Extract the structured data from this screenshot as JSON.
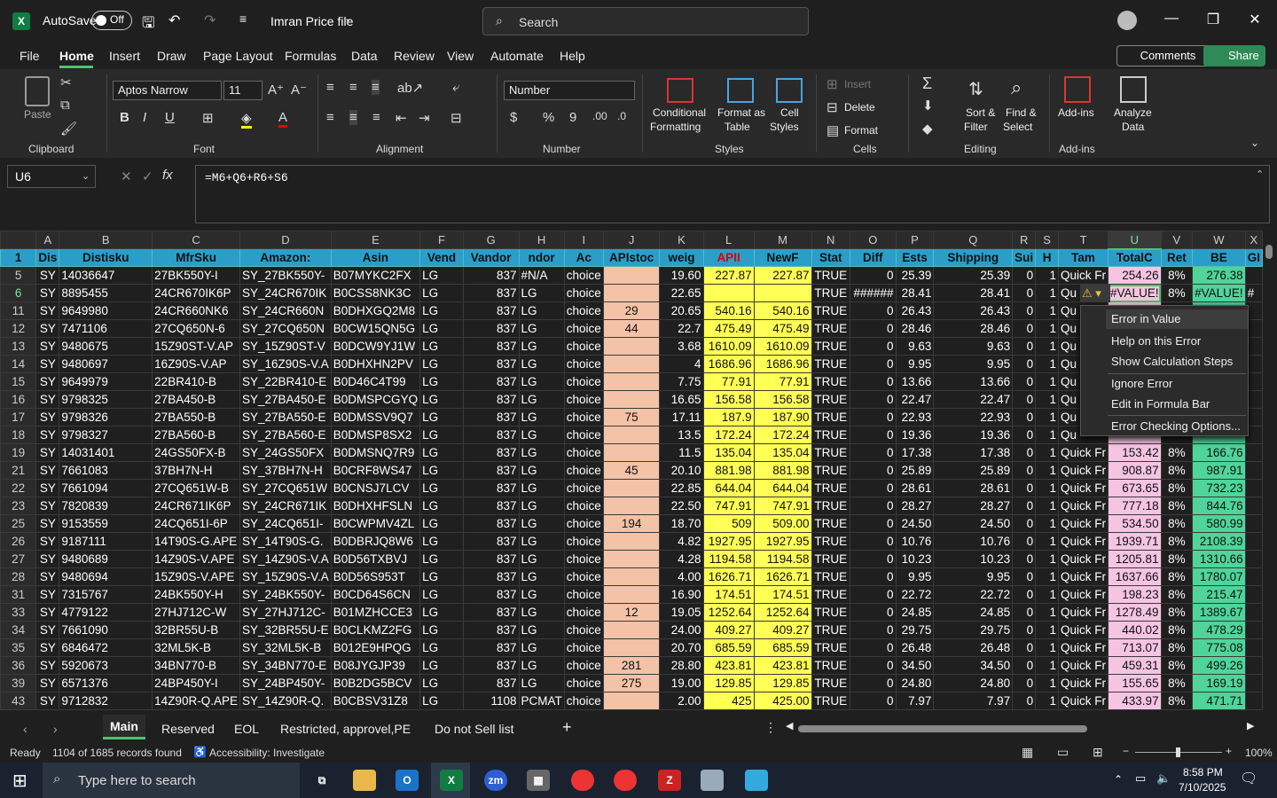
{
  "titlebar": {
    "autosave_label": "AutoSave",
    "autosave_state": "Off",
    "file_name": "Imran Price file",
    "search_placeholder": "Search"
  },
  "menu": [
    "File",
    "Home",
    "Insert",
    "Draw",
    "Page Layout",
    "Formulas",
    "Data",
    "Review",
    "View",
    "Automate",
    "Help"
  ],
  "menu_active": "Home",
  "comments_label": "Comments",
  "share_label": "Share",
  "ribbon": {
    "clipboard": {
      "label": "Clipboard",
      "paste": "Paste"
    },
    "font": {
      "label": "Font",
      "name": "Aptos Narrow",
      "size": "11"
    },
    "alignment": {
      "label": "Alignment"
    },
    "number": {
      "label": "Number",
      "format": "Number"
    },
    "styles": {
      "label": "Styles",
      "conditional": "Conditional",
      "conditional2": "Formatting",
      "format_as": "Format as",
      "table": "Table",
      "cell": "Cell",
      "cell2": "Styles"
    },
    "cells": {
      "label": "Cells",
      "insert": "Insert",
      "delete": "Delete",
      "format": "Format"
    },
    "editing": {
      "label": "Editing",
      "sort": "Sort &",
      "filter": "Filter",
      "find": "Find &",
      "select": "Select"
    },
    "addins": {
      "label": "Add-ins",
      "addins": "Add-ins",
      "analyze": "Analyze",
      "data": "Data"
    }
  },
  "formula_bar": {
    "name_box": "U6",
    "formula": "=M6+Q6+R6+S6"
  },
  "columns": [
    "A",
    "B",
    "C",
    "D",
    "E",
    "F",
    "G",
    "H",
    "I",
    "J",
    "K",
    "L",
    "M",
    "N",
    "O",
    "P",
    "Q",
    "R",
    "S",
    "T",
    "U",
    "V",
    "W",
    "X"
  ],
  "header_row": {
    "row": "1",
    "cells": [
      "Dis",
      "Distisku",
      "MfrSku",
      "Amazon:",
      "Asin",
      "Vend",
      "Vandor",
      "ndor",
      "Ac",
      "APIstoc",
      "weig",
      "APII",
      "NewF",
      "Stat",
      "Diff",
      "Ests",
      "Shipping",
      "Sui",
      "H",
      "Tam",
      "TotalC",
      "Ret",
      "BE",
      "GI"
    ]
  },
  "rows": [
    {
      "n": "5",
      "v": [
        "SY",
        "14036647",
        "27BK550Y-I",
        "SY_27BK550Y-",
        "B07MYKC2FX",
        "LG",
        "837",
        "#N/A",
        "choice",
        "",
        "19.60",
        "227.87",
        "227.87",
        "TRUE",
        "0",
        "25.39",
        "25.39",
        "0",
        "1",
        "Quick Fr",
        "254.26",
        "8%",
        "276.38",
        ""
      ]
    },
    {
      "n": "6",
      "v": [
        "SY",
        "8895455",
        "24CR670IK6P",
        "SY_24CR670IK",
        "B0CSS8NK3C",
        "LG",
        "837",
        "LG",
        "choice",
        "",
        "22.65",
        "",
        "",
        "TRUE",
        "######",
        "28.41",
        "28.41",
        "0",
        "1",
        "Qu",
        "#VALUE!",
        "8%",
        "#VALUE!",
        "#"
      ]
    },
    {
      "n": "11",
      "v": [
        "SY",
        "9649980",
        "24CR660NK6",
        "SY_24CR660N",
        "B0DHXGQ2M8",
        "LG",
        "837",
        "LG",
        "choice",
        "29",
        "20.65",
        "540.16",
        "540.16",
        "TRUE",
        "0",
        "26.43",
        "26.43",
        "0",
        "1",
        "Qu",
        "",
        "",
        "",
        ""
      ]
    },
    {
      "n": "12",
      "v": [
        "SY",
        "7471106",
        "27CQ650N-6",
        "SY_27CQ650N",
        "B0CW15QN5G",
        "LG",
        "837",
        "LG",
        "choice",
        "44",
        "22.7",
        "475.49",
        "475.49",
        "TRUE",
        "0",
        "28.46",
        "28.46",
        "0",
        "1",
        "Qu",
        "",
        "",
        "",
        ""
      ]
    },
    {
      "n": "13",
      "v": [
        "SY",
        "9480675",
        "15Z90ST-V.AP",
        "SY_15Z90ST-V",
        "B0DCW9YJ1W",
        "LG",
        "837",
        "LG",
        "choice",
        "",
        "3.68",
        "1610.09",
        "1610.09",
        "TRUE",
        "0",
        "9.63",
        "9.63",
        "0",
        "1",
        "Qu",
        "",
        "",
        "",
        ""
      ]
    },
    {
      "n": "14",
      "v": [
        "SY",
        "9480697",
        "16Z90S-V.AP",
        "SY_16Z90S-V.A",
        "B0DHXHN2PV",
        "LG",
        "837",
        "LG",
        "choice",
        "",
        "4",
        "1686.96",
        "1686.96",
        "TRUE",
        "0",
        "9.95",
        "9.95",
        "0",
        "1",
        "Qu",
        "",
        "",
        "",
        ""
      ]
    },
    {
      "n": "15",
      "v": [
        "SY",
        "9649979",
        "22BR410-B",
        "SY_22BR410-E",
        "B0D46C4T99",
        "LG",
        "837",
        "LG",
        "choice",
        "",
        "7.75",
        "77.91",
        "77.91",
        "TRUE",
        "0",
        "13.66",
        "13.66",
        "0",
        "1",
        "Qu",
        "",
        "",
        "",
        ""
      ]
    },
    {
      "n": "16",
      "v": [
        "SY",
        "9798325",
        "27BA450-B",
        "SY_27BA450-E",
        "B0DMSPCGYQ",
        "LG",
        "837",
        "LG",
        "choice",
        "",
        "16.65",
        "156.58",
        "156.58",
        "TRUE",
        "0",
        "22.47",
        "22.47",
        "0",
        "1",
        "Qu",
        "",
        "",
        "",
        ""
      ]
    },
    {
      "n": "17",
      "v": [
        "SY",
        "9798326",
        "27BA550-B",
        "SY_27BA550-E",
        "B0DMSSV9Q7",
        "LG",
        "837",
        "LG",
        "choice",
        "75",
        "17.11",
        "187.9",
        "187.90",
        "TRUE",
        "0",
        "22.93",
        "22.93",
        "0",
        "1",
        "Qu",
        "",
        "",
        "",
        ""
      ]
    },
    {
      "n": "18",
      "v": [
        "SY",
        "9798327",
        "27BA560-B",
        "SY_27BA560-E",
        "B0DMSP8SX2",
        "LG",
        "837",
        "LG",
        "choice",
        "",
        "13.5",
        "172.24",
        "172.24",
        "TRUE",
        "0",
        "19.36",
        "19.36",
        "0",
        "1",
        "Qu",
        "",
        "",
        "",
        ""
      ]
    },
    {
      "n": "19",
      "v": [
        "SY",
        "14031401",
        "24GS50FX-B",
        "SY_24GS50FX",
        "B0DMSNQ7R9",
        "LG",
        "837",
        "LG",
        "choice",
        "",
        "11.5",
        "135.04",
        "135.04",
        "TRUE",
        "0",
        "17.38",
        "17.38",
        "0",
        "1",
        "Quick Fr",
        "153.42",
        "8%",
        "166.76",
        ""
      ]
    },
    {
      "n": "21",
      "v": [
        "SY",
        "7661083",
        "37BH7N-H",
        "SY_37BH7N-H",
        "B0CRF8WS47",
        "LG",
        "837",
        "LG",
        "choice",
        "45",
        "20.10",
        "881.98",
        "881.98",
        "TRUE",
        "0",
        "25.89",
        "25.89",
        "0",
        "1",
        "Quick Fr",
        "908.87",
        "8%",
        "987.91",
        ""
      ]
    },
    {
      "n": "22",
      "v": [
        "SY",
        "7661094",
        "27CQ651W-B",
        "SY_27CQ651W",
        "B0CNSJ7LCV",
        "LG",
        "837",
        "LG",
        "choice",
        "",
        "22.85",
        "644.04",
        "644.04",
        "TRUE",
        "0",
        "28.61",
        "28.61",
        "0",
        "1",
        "Quick Fr",
        "673.65",
        "8%",
        "732.23",
        ""
      ]
    },
    {
      "n": "23",
      "v": [
        "SY",
        "7820839",
        "24CR671IK6P",
        "SY_24CR671IK",
        "B0DHXHFSLN",
        "LG",
        "837",
        "LG",
        "choice",
        "",
        "22.50",
        "747.91",
        "747.91",
        "TRUE",
        "0",
        "28.27",
        "28.27",
        "0",
        "1",
        "Quick Fr",
        "777.18",
        "8%",
        "844.76",
        ""
      ]
    },
    {
      "n": "25",
      "v": [
        "SY",
        "9153559",
        "24CQ651I-6P",
        "SY_24CQ651I-",
        "B0CWPMV4ZL",
        "LG",
        "837",
        "LG",
        "choice",
        "194",
        "18.70",
        "509",
        "509.00",
        "TRUE",
        "0",
        "24.50",
        "24.50",
        "0",
        "1",
        "Quick Fr",
        "534.50",
        "8%",
        "580.99",
        ""
      ]
    },
    {
      "n": "26",
      "v": [
        "SY",
        "9187111",
        "14T90S-G.APE",
        "SY_14T90S-G.",
        "B0DBRJQ8W6",
        "LG",
        "837",
        "LG",
        "choice",
        "",
        "4.82",
        "1927.95",
        "1927.95",
        "TRUE",
        "0",
        "10.76",
        "10.76",
        "0",
        "1",
        "Quick Fr",
        "1939.71",
        "8%",
        "2108.39",
        ""
      ]
    },
    {
      "n": "27",
      "v": [
        "SY",
        "9480689",
        "14Z90S-V.APE",
        "SY_14Z90S-V.A",
        "B0D56TXBVJ",
        "LG",
        "837",
        "LG",
        "choice",
        "",
        "4.28",
        "1194.58",
        "1194.58",
        "TRUE",
        "0",
        "10.23",
        "10.23",
        "0",
        "1",
        "Quick Fr",
        "1205.81",
        "8%",
        "1310.66",
        ""
      ]
    },
    {
      "n": "28",
      "v": [
        "SY",
        "9480694",
        "15Z90S-V.APE",
        "SY_15Z90S-V.A",
        "B0D56S953T",
        "LG",
        "837",
        "LG",
        "choice",
        "",
        "4.00",
        "1626.71",
        "1626.71",
        "TRUE",
        "0",
        "9.95",
        "9.95",
        "0",
        "1",
        "Quick Fr",
        "1637.66",
        "8%",
        "1780.07",
        ""
      ]
    },
    {
      "n": "31",
      "v": [
        "SY",
        "7315767",
        "24BK550Y-H",
        "SY_24BK550Y-",
        "B0CD64S6CN",
        "LG",
        "837",
        "LG",
        "choice",
        "",
        "16.90",
        "174.51",
        "174.51",
        "TRUE",
        "0",
        "22.72",
        "22.72",
        "0",
        "1",
        "Quick Fr",
        "198.23",
        "8%",
        "215.47",
        ""
      ]
    },
    {
      "n": "33",
      "v": [
        "SY",
        "4779122",
        "27HJ712C-W",
        "SY_27HJ712C-",
        "B01MZHCCE3",
        "LG",
        "837",
        "LG",
        "choice",
        "12",
        "19.05",
        "1252.64",
        "1252.64",
        "TRUE",
        "0",
        "24.85",
        "24.85",
        "0",
        "1",
        "Quick Fr",
        "1278.49",
        "8%",
        "1389.67",
        ""
      ]
    },
    {
      "n": "34",
      "v": [
        "SY",
        "7661090",
        "32BR55U-B",
        "SY_32BR55U-E",
        "B0CLKMZ2FG",
        "LG",
        "837",
        "LG",
        "choice",
        "",
        "24.00",
        "409.27",
        "409.27",
        "TRUE",
        "0",
        "29.75",
        "29.75",
        "0",
        "1",
        "Quick Fr",
        "440.02",
        "8%",
        "478.29",
        ""
      ]
    },
    {
      "n": "35",
      "v": [
        "SY",
        "6846472",
        "32ML5K-B",
        "SY_32ML5K-B",
        "B012E9HPQG",
        "LG",
        "837",
        "LG",
        "choice",
        "",
        "20.70",
        "685.59",
        "685.59",
        "TRUE",
        "0",
        "26.48",
        "26.48",
        "0",
        "1",
        "Quick Fr",
        "713.07",
        "8%",
        "775.08",
        ""
      ]
    },
    {
      "n": "36",
      "v": [
        "SY",
        "5920673",
        "34BN770-B",
        "SY_34BN770-E",
        "B08JYGJP39",
        "LG",
        "837",
        "LG",
        "choice",
        "281",
        "28.80",
        "423.81",
        "423.81",
        "TRUE",
        "0",
        "34.50",
        "34.50",
        "0",
        "1",
        "Quick Fr",
        "459.31",
        "8%",
        "499.26",
        ""
      ]
    },
    {
      "n": "39",
      "v": [
        "SY",
        "6571376",
        "24BP450Y-I",
        "SY_24BP450Y-",
        "B0B2DG5BCV",
        "LG",
        "837",
        "LG",
        "choice",
        "275",
        "19.00",
        "129.85",
        "129.85",
        "TRUE",
        "0",
        "24.80",
        "24.80",
        "0",
        "1",
        "Quick Fr",
        "155.65",
        "8%",
        "169.19",
        ""
      ]
    },
    {
      "n": "43",
      "v": [
        "SY",
        "9712832",
        "14Z90R-Q.APE",
        "SY_14Z90R-Q.",
        "B0CBSV31Z8",
        "LG",
        "1108",
        "PCMAT",
        "choice",
        "",
        "2.00",
        "425",
        "425.00",
        "TRUE",
        "0",
        "7.97",
        "7.97",
        "0",
        "1",
        "Quick Fr",
        "433.97",
        "8%",
        "471.71",
        ""
      ]
    }
  ],
  "context_menu": [
    "Error in Value",
    "Help on this Error",
    "Show Calculation Steps",
    "Ignore Error",
    "Edit in Formula Bar",
    "Error Checking Options..."
  ],
  "sheet_tabs": [
    "Main",
    "Reserved",
    "EOL",
    "Restricted, approvel,PE",
    "Do not Sell list"
  ],
  "status": {
    "ready": "Ready",
    "records": "1104 of 1685 records found",
    "accessibility": "Accessibility: Investigate",
    "zoom": "100%"
  },
  "taskbar": {
    "search_placeholder": "Type here to search",
    "time": "8:58 PM",
    "date": "7/10/2025"
  },
  "colors": {
    "header_blue": "#2a9ec9",
    "salmon": "#f4c2a7",
    "yellow": "#ffff55",
    "pink": "#f5c4e2",
    "green": "#4fd49a",
    "accent": "#4fc26e"
  }
}
